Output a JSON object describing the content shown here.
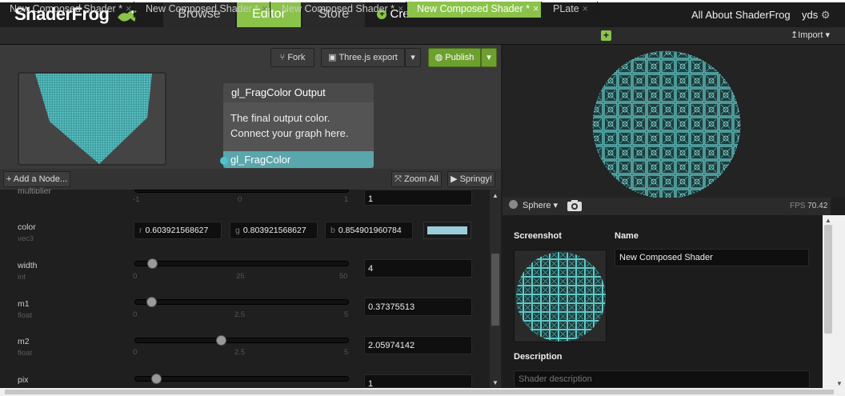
{
  "brand": {
    "name": "ShaderFrog"
  },
  "nav": {
    "browse": "Browse",
    "editor": "Editor",
    "store": "Store",
    "create": "Create",
    "about": "All About ShaderFrog",
    "user": "yds"
  },
  "tabs": [
    {
      "label": "New Composed Shader *"
    },
    {
      "label": "New Composed Shader *"
    },
    {
      "label": "New Composed Shader *"
    },
    {
      "label": "New Composed Shader *"
    },
    {
      "label": "PLate"
    }
  ],
  "tab_close": "×",
  "import_label": "Import",
  "toolbar": {
    "fork": "Fork",
    "threejs_export": "Three.js export",
    "publish": "Publish"
  },
  "output_node": {
    "title": "gl_FragColor Output",
    "description_line1": "The final output color.",
    "description_line2": "Connect your graph here.",
    "port": "gl_FragColor"
  },
  "graph_controls": {
    "add_node": "Add a Node...",
    "zoom_all": "Zoom All",
    "springy": "Springy!"
  },
  "uniforms": {
    "partial": {
      "label": "multiplier",
      "ticks": [
        "-1",
        "0",
        "1"
      ],
      "value": "1"
    },
    "color": {
      "label": "color",
      "type": "vec3",
      "r_label": "r",
      "r": "0.603921568627",
      "g_label": "g",
      "g": "0.803921568627",
      "b_label": "b",
      "b": "0.854901960784",
      "swatch": "#9acdda"
    },
    "width": {
      "label": "width",
      "type": "int",
      "ticks": [
        "0",
        "25",
        "50"
      ],
      "value": "4",
      "level": 0.08
    },
    "m1": {
      "label": "m1",
      "type": "float",
      "ticks": [
        "0",
        "2.5",
        "5"
      ],
      "value": "0.37375513",
      "level": 0.075
    },
    "m2": {
      "label": "m2",
      "type": "float",
      "ticks": [
        "0",
        "2.5",
        "5"
      ],
      "value": "2.05974142",
      "level": 0.41
    },
    "pix": {
      "label": "pix",
      "value": "1",
      "level": 0.1
    }
  },
  "preview": {
    "geometry": "Sphere",
    "fps_label": "FPS",
    "fps": "70.42"
  },
  "info": {
    "screenshot_label": "Screenshot",
    "name_label": "Name",
    "name_value": "New Composed Shader",
    "description_label": "Description",
    "description_placeholder": "Shader description"
  },
  "colors": {
    "accent": "#8bc34a",
    "port": "#5aa6ad",
    "pattern": "#5ec8c8"
  }
}
